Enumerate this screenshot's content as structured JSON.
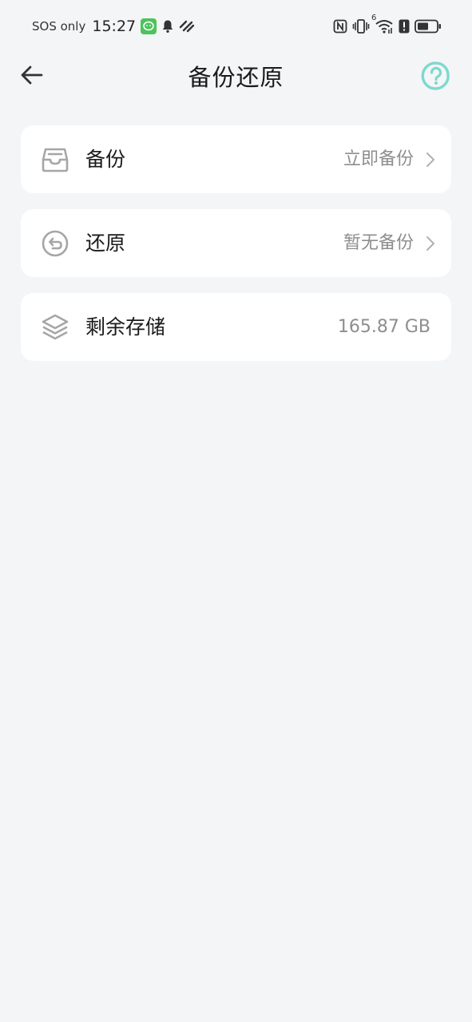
{
  "status_bar": {
    "carrier": "SOS only",
    "time": "15:27",
    "icons_left": [
      "wechat-app-icon",
      "bell-icon",
      "link-app-icon"
    ],
    "icons_right": [
      "nfc-icon",
      "vibrate-icon",
      "wifi-icon",
      "alert-icon",
      "battery-icon"
    ],
    "wifi_superscript": "6"
  },
  "header": {
    "title": "备份还原",
    "back_icon": "arrow-left-icon",
    "help_icon": "help-icon"
  },
  "items": [
    {
      "icon": "inbox-tray-icon",
      "label": "备份",
      "value": "立即备份",
      "has_chevron": true
    },
    {
      "icon": "undo-circle-icon",
      "label": "还原",
      "value": "暂无备份",
      "has_chevron": true
    },
    {
      "icon": "layers-icon",
      "label": "剩余存储",
      "value": "165.87 GB",
      "has_chevron": false
    }
  ],
  "colors": {
    "background": "#f4f5f7",
    "card": "#ffffff",
    "accent": "#7ed9cc",
    "secondary_text": "#8e8e8e",
    "icon_gray": "#a6a6a6"
  }
}
